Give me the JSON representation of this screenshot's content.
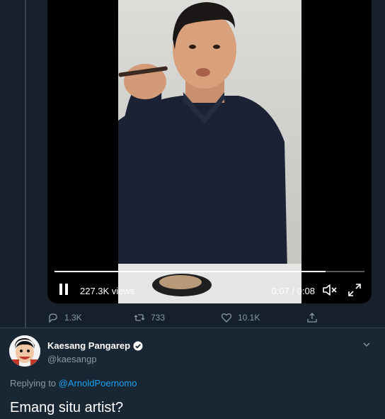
{
  "video": {
    "views": "227.3K views",
    "time": "0:07 / 0:08",
    "progress": 0.875
  },
  "actions": {
    "replies": "1.3K",
    "retweets": "733",
    "likes": "10.1K"
  },
  "reply_tweet": {
    "name": "Kaesang Pangarep",
    "handle": "@kaesangp",
    "replying_prefix": "Replying to",
    "replying_to": "@ArnoldPoernomo",
    "text": "Emang situ artist?"
  },
  "colors": {
    "background": "#15202b",
    "card": "#192734",
    "link": "#1da1f2",
    "muted": "#8899a6"
  },
  "icons": [
    "pause-icon",
    "volume-muted-icon",
    "fullscreen-icon",
    "reply-icon",
    "retweet-icon",
    "like-icon",
    "share-icon",
    "verified-badge-icon",
    "chevron-down-icon"
  ]
}
